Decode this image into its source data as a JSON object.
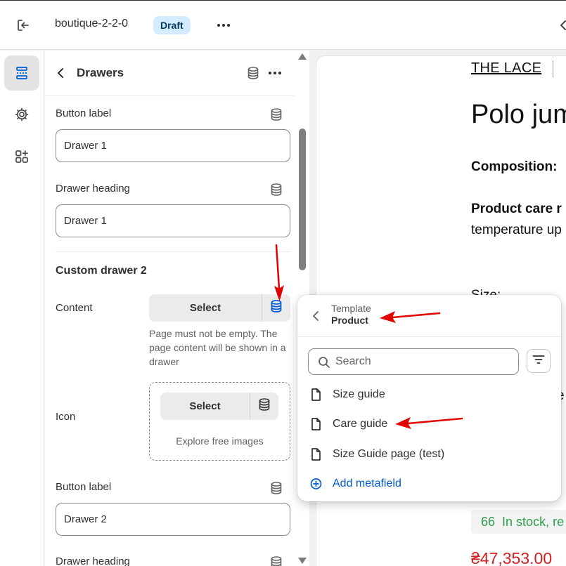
{
  "topbar": {
    "title": "boutique-2-2-0",
    "badge": "Draft",
    "exit_icon": "exit-icon",
    "more_icon": "more-horizontal-icon"
  },
  "rail": {
    "items": [
      {
        "icon": "sections-icon",
        "active": true
      },
      {
        "icon": "gear-icon",
        "active": false
      },
      {
        "icon": "apps-icon",
        "active": false
      }
    ]
  },
  "panel": {
    "title": "Drawers",
    "fields": {
      "button_label_1": {
        "label": "Button label",
        "value": "Drawer 1"
      },
      "drawer_heading_1": {
        "label": "Drawer heading",
        "value": "Drawer 1"
      },
      "section_title": "Custom drawer 2",
      "content": {
        "label": "Content",
        "button": "Select",
        "help": "Page must not be empty. The page content will be shown in a drawer"
      },
      "icon": {
        "label": "Icon",
        "button": "Select",
        "explore": "Explore free images"
      },
      "button_label_2": {
        "label": "Button label",
        "value": "Drawer 2"
      },
      "drawer_heading_2": {
        "label": "Drawer heading"
      }
    }
  },
  "scroll": {
    "position_fraction": 0.18
  },
  "preview": {
    "brand": "THE LACE",
    "title": "Polo jum",
    "composition": "Composition:",
    "care": "Product care r",
    "care_text": "temperature up",
    "size": "Size:",
    "e_letter": "e",
    "stock_count": "66",
    "stock_text": "In stock, re",
    "price": "₴47,353.00"
  },
  "popover": {
    "crumb_parent": "Template",
    "crumb_current": "Product",
    "search_placeholder": "Search",
    "items": [
      {
        "label": "Size guide",
        "icon": "page-icon"
      },
      {
        "label": "Care guide",
        "icon": "page-icon"
      },
      {
        "label": "Size Guide page (test)",
        "icon": "page-icon"
      }
    ],
    "add_label": "Add metafield"
  },
  "colors": {
    "accent_blue": "#005bd3",
    "annotation_red": "#e00000",
    "badge_bg": "#d5ebff",
    "stock_green": "#2c9e4a",
    "price_red": "#d21f1f"
  }
}
